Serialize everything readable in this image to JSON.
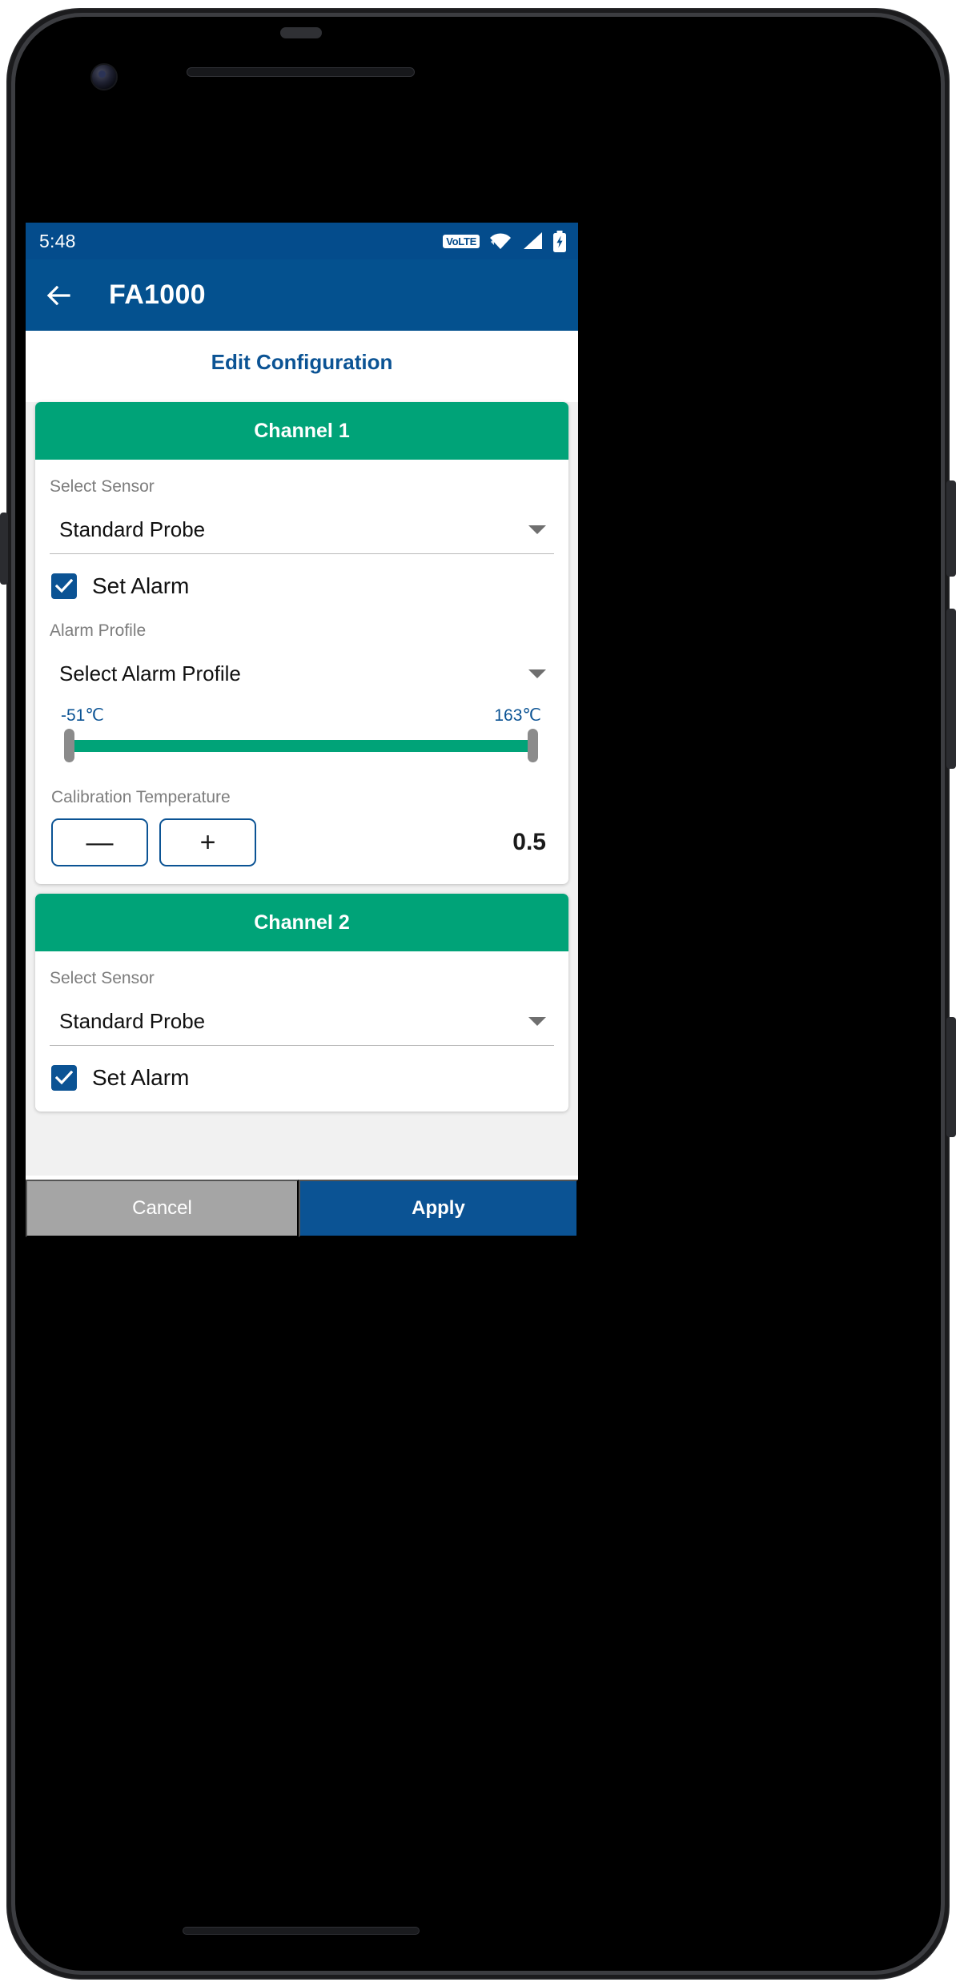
{
  "status_bar": {
    "time": "5:48",
    "volte_label": "VoLTE",
    "icons": [
      "volte-icon",
      "wifi-icon",
      "signal-icon",
      "battery-charging-icon"
    ]
  },
  "app_bar": {
    "back_icon": "back-arrow-icon",
    "title": "FA1000"
  },
  "page": {
    "heading": "Edit Configuration"
  },
  "channels": [
    {
      "title": "Channel 1",
      "sensor_label": "Select Sensor",
      "sensor_value": "Standard Probe",
      "alarm_checkbox_label": "Set Alarm",
      "alarm_checked": true,
      "alarm_profile_label": "Alarm Profile",
      "alarm_profile_value": "Select Alarm Profile",
      "slider_min_label": "-51℃",
      "slider_max_label": "163℃",
      "calibration_label": "Calibration Temperature",
      "decrement_label": "—",
      "increment_label": "+",
      "calibration_value": "0.5"
    },
    {
      "title": "Channel 2",
      "sensor_label": "Select Sensor",
      "sensor_value": "Standard Probe",
      "alarm_checkbox_label": "Set Alarm",
      "alarm_checked": true
    }
  ],
  "actions": {
    "cancel_label": "Cancel",
    "apply_label": "Apply"
  },
  "colors": {
    "app_bar_blue": "#04518f",
    "status_blue": "#044c8c",
    "channel_green": "#00a378",
    "accent_blue": "#0b5394",
    "cancel_gray": "#a5a5a5"
  }
}
